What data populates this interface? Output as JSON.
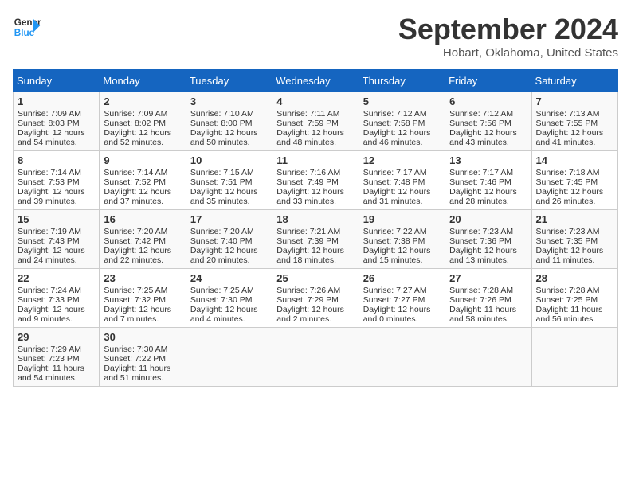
{
  "logo": {
    "line1": "General",
    "line2": "Blue"
  },
  "title": "September 2024",
  "subtitle": "Hobart, Oklahoma, United States",
  "days_of_week": [
    "Sunday",
    "Monday",
    "Tuesday",
    "Wednesday",
    "Thursday",
    "Friday",
    "Saturday"
  ],
  "weeks": [
    [
      {
        "day": "1",
        "sunrise": "Sunrise: 7:09 AM",
        "sunset": "Sunset: 8:03 PM",
        "daylight": "Daylight: 12 hours and 54 minutes."
      },
      {
        "day": "2",
        "sunrise": "Sunrise: 7:09 AM",
        "sunset": "Sunset: 8:02 PM",
        "daylight": "Daylight: 12 hours and 52 minutes."
      },
      {
        "day": "3",
        "sunrise": "Sunrise: 7:10 AM",
        "sunset": "Sunset: 8:00 PM",
        "daylight": "Daylight: 12 hours and 50 minutes."
      },
      {
        "day": "4",
        "sunrise": "Sunrise: 7:11 AM",
        "sunset": "Sunset: 7:59 PM",
        "daylight": "Daylight: 12 hours and 48 minutes."
      },
      {
        "day": "5",
        "sunrise": "Sunrise: 7:12 AM",
        "sunset": "Sunset: 7:58 PM",
        "daylight": "Daylight: 12 hours and 46 minutes."
      },
      {
        "day": "6",
        "sunrise": "Sunrise: 7:12 AM",
        "sunset": "Sunset: 7:56 PM",
        "daylight": "Daylight: 12 hours and 43 minutes."
      },
      {
        "day": "7",
        "sunrise": "Sunrise: 7:13 AM",
        "sunset": "Sunset: 7:55 PM",
        "daylight": "Daylight: 12 hours and 41 minutes."
      }
    ],
    [
      {
        "day": "8",
        "sunrise": "Sunrise: 7:14 AM",
        "sunset": "Sunset: 7:53 PM",
        "daylight": "Daylight: 12 hours and 39 minutes."
      },
      {
        "day": "9",
        "sunrise": "Sunrise: 7:14 AM",
        "sunset": "Sunset: 7:52 PM",
        "daylight": "Daylight: 12 hours and 37 minutes."
      },
      {
        "day": "10",
        "sunrise": "Sunrise: 7:15 AM",
        "sunset": "Sunset: 7:51 PM",
        "daylight": "Daylight: 12 hours and 35 minutes."
      },
      {
        "day": "11",
        "sunrise": "Sunrise: 7:16 AM",
        "sunset": "Sunset: 7:49 PM",
        "daylight": "Daylight: 12 hours and 33 minutes."
      },
      {
        "day": "12",
        "sunrise": "Sunrise: 7:17 AM",
        "sunset": "Sunset: 7:48 PM",
        "daylight": "Daylight: 12 hours and 31 minutes."
      },
      {
        "day": "13",
        "sunrise": "Sunrise: 7:17 AM",
        "sunset": "Sunset: 7:46 PM",
        "daylight": "Daylight: 12 hours and 28 minutes."
      },
      {
        "day": "14",
        "sunrise": "Sunrise: 7:18 AM",
        "sunset": "Sunset: 7:45 PM",
        "daylight": "Daylight: 12 hours and 26 minutes."
      }
    ],
    [
      {
        "day": "15",
        "sunrise": "Sunrise: 7:19 AM",
        "sunset": "Sunset: 7:43 PM",
        "daylight": "Daylight: 12 hours and 24 minutes."
      },
      {
        "day": "16",
        "sunrise": "Sunrise: 7:20 AM",
        "sunset": "Sunset: 7:42 PM",
        "daylight": "Daylight: 12 hours and 22 minutes."
      },
      {
        "day": "17",
        "sunrise": "Sunrise: 7:20 AM",
        "sunset": "Sunset: 7:40 PM",
        "daylight": "Daylight: 12 hours and 20 minutes."
      },
      {
        "day": "18",
        "sunrise": "Sunrise: 7:21 AM",
        "sunset": "Sunset: 7:39 PM",
        "daylight": "Daylight: 12 hours and 18 minutes."
      },
      {
        "day": "19",
        "sunrise": "Sunrise: 7:22 AM",
        "sunset": "Sunset: 7:38 PM",
        "daylight": "Daylight: 12 hours and 15 minutes."
      },
      {
        "day": "20",
        "sunrise": "Sunrise: 7:23 AM",
        "sunset": "Sunset: 7:36 PM",
        "daylight": "Daylight: 12 hours and 13 minutes."
      },
      {
        "day": "21",
        "sunrise": "Sunrise: 7:23 AM",
        "sunset": "Sunset: 7:35 PM",
        "daylight": "Daylight: 12 hours and 11 minutes."
      }
    ],
    [
      {
        "day": "22",
        "sunrise": "Sunrise: 7:24 AM",
        "sunset": "Sunset: 7:33 PM",
        "daylight": "Daylight: 12 hours and 9 minutes."
      },
      {
        "day": "23",
        "sunrise": "Sunrise: 7:25 AM",
        "sunset": "Sunset: 7:32 PM",
        "daylight": "Daylight: 12 hours and 7 minutes."
      },
      {
        "day": "24",
        "sunrise": "Sunrise: 7:25 AM",
        "sunset": "Sunset: 7:30 PM",
        "daylight": "Daylight: 12 hours and 4 minutes."
      },
      {
        "day": "25",
        "sunrise": "Sunrise: 7:26 AM",
        "sunset": "Sunset: 7:29 PM",
        "daylight": "Daylight: 12 hours and 2 minutes."
      },
      {
        "day": "26",
        "sunrise": "Sunrise: 7:27 AM",
        "sunset": "Sunset: 7:27 PM",
        "daylight": "Daylight: 12 hours and 0 minutes."
      },
      {
        "day": "27",
        "sunrise": "Sunrise: 7:28 AM",
        "sunset": "Sunset: 7:26 PM",
        "daylight": "Daylight: 11 hours and 58 minutes."
      },
      {
        "day": "28",
        "sunrise": "Sunrise: 7:28 AM",
        "sunset": "Sunset: 7:25 PM",
        "daylight": "Daylight: 11 hours and 56 minutes."
      }
    ],
    [
      {
        "day": "29",
        "sunrise": "Sunrise: 7:29 AM",
        "sunset": "Sunset: 7:23 PM",
        "daylight": "Daylight: 11 hours and 54 minutes."
      },
      {
        "day": "30",
        "sunrise": "Sunrise: 7:30 AM",
        "sunset": "Sunset: 7:22 PM",
        "daylight": "Daylight: 11 hours and 51 minutes."
      },
      null,
      null,
      null,
      null,
      null
    ]
  ]
}
